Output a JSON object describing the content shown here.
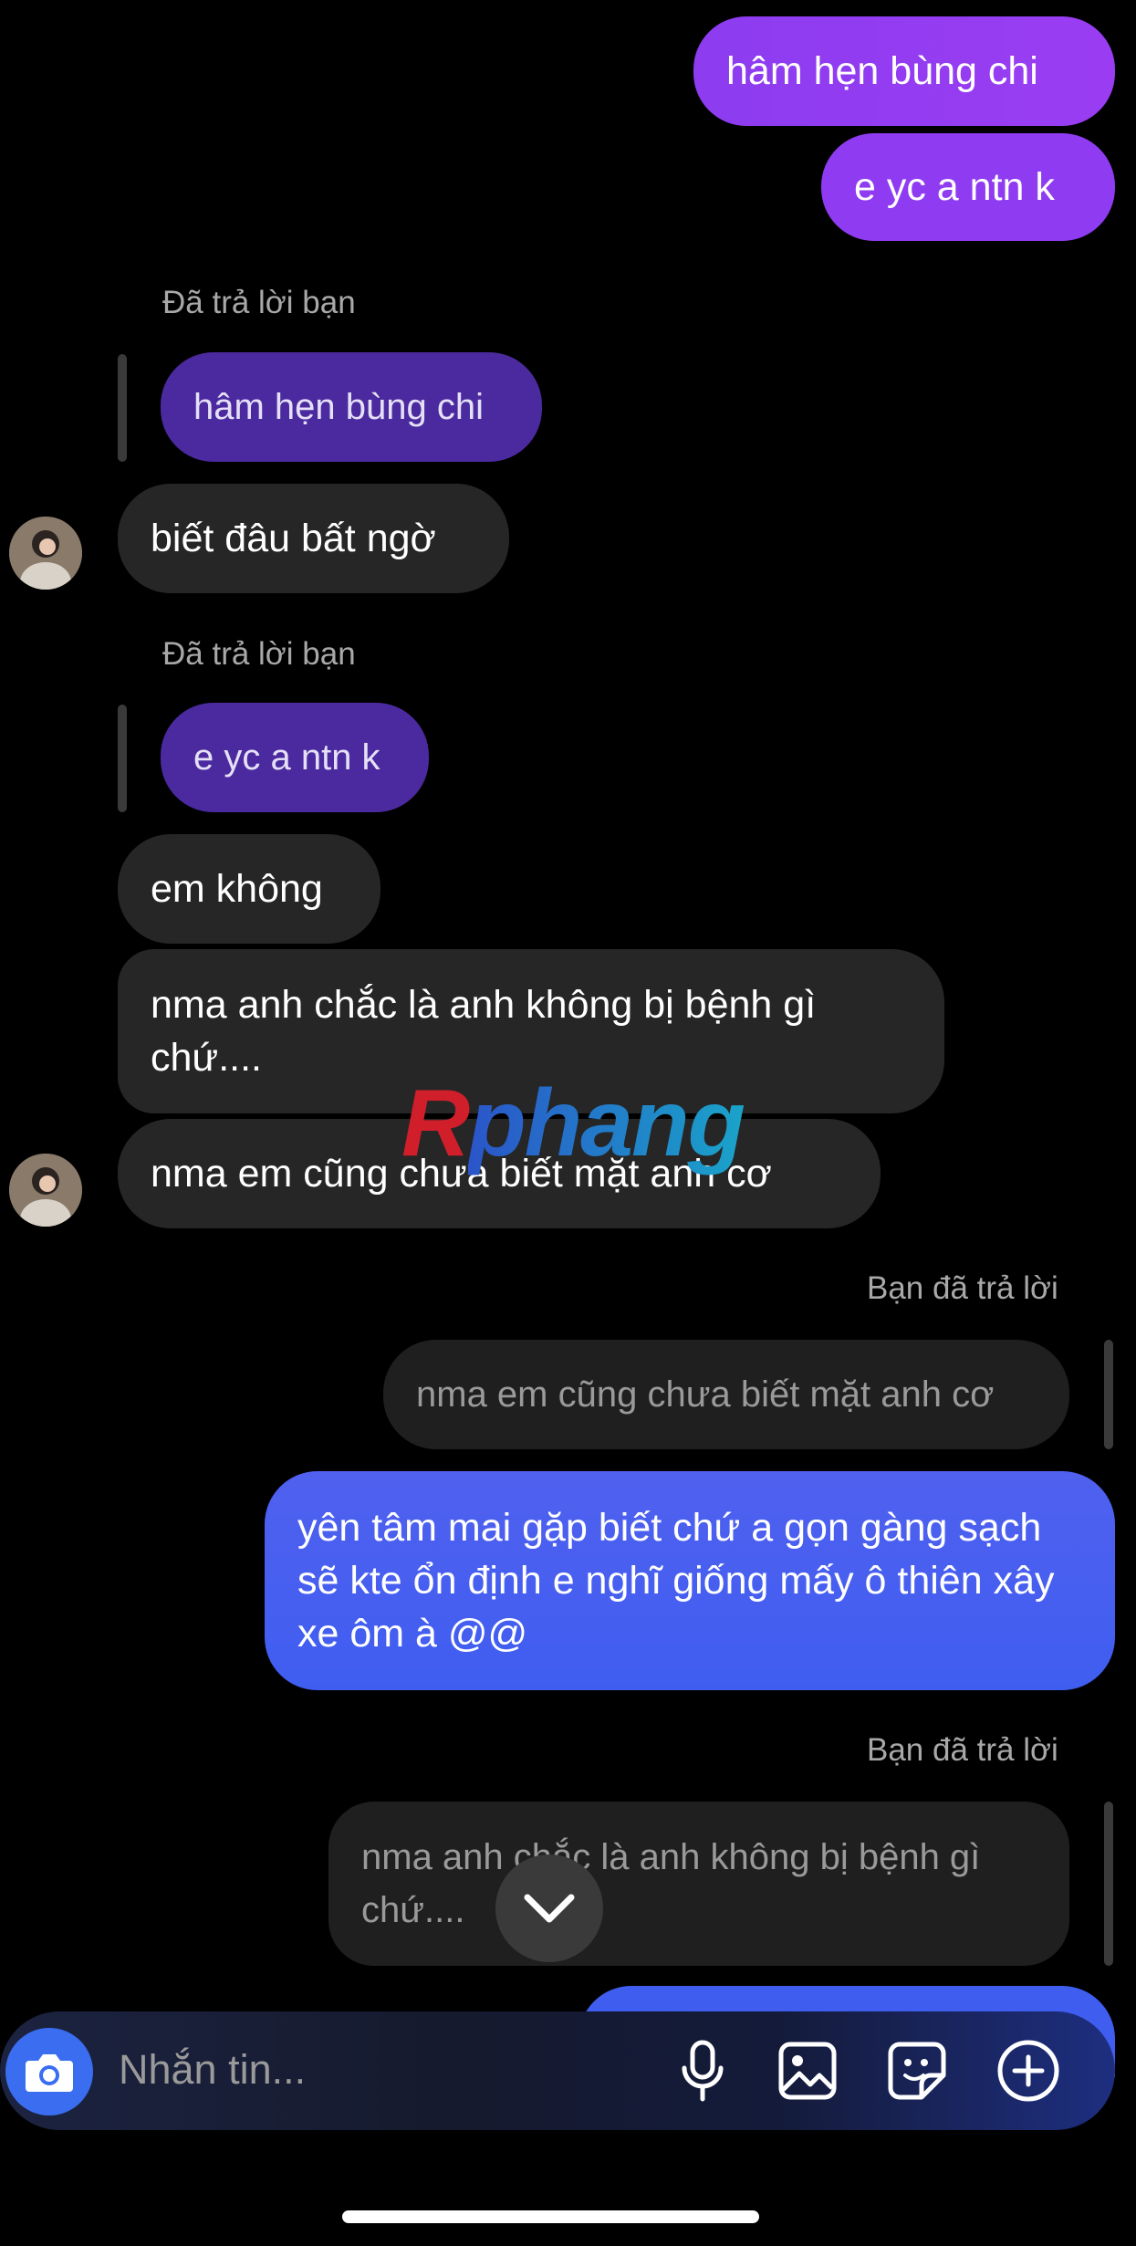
{
  "messages": {
    "out1": "hâm hẹn bùng chi",
    "out2": "e yc a ntn k",
    "reply_label_1": "Đã trả lời bạn",
    "quote_1": "hâm hẹn bùng chi",
    "in1": "biết đâu bất ngờ",
    "reply_label_2": "Đã trả lời bạn",
    "quote_2": "e yc a ntn k",
    "in2": "em không",
    "in3": "nma anh chắc là anh không bị bệnh gì chứ....",
    "in4": "nma em cũng chưa biết mặt anh cơ",
    "reply_label_3": "Bạn đã trả lời",
    "quote_3": "nma em cũng chưa biết mặt anh cơ",
    "out3": "yên tâm mai gặp biết chứ a gọn gàng sạch sẽ kte ổn định e nghĩ giống mấy ô thiên xây xe ôm à @@",
    "reply_label_4": "Bạn đã trả lời",
    "quote_4": "nma anh chắc là anh không bị bệnh gì chứ...."
  },
  "watermark": {
    "part1": "R",
    "part2": "phang"
  },
  "composer": {
    "placeholder": "Nhắn tin...",
    "icons": [
      "camera-icon",
      "microphone-icon",
      "image-icon",
      "sticker-icon",
      "plus-icon"
    ]
  },
  "colors": {
    "purple_bubble": "#8a3cf0",
    "blue_bubble": "#3f5ef0",
    "incoming_bubble": "#262626",
    "quote_purple": "#4a2a9e",
    "camera_button": "#3a6df0"
  }
}
